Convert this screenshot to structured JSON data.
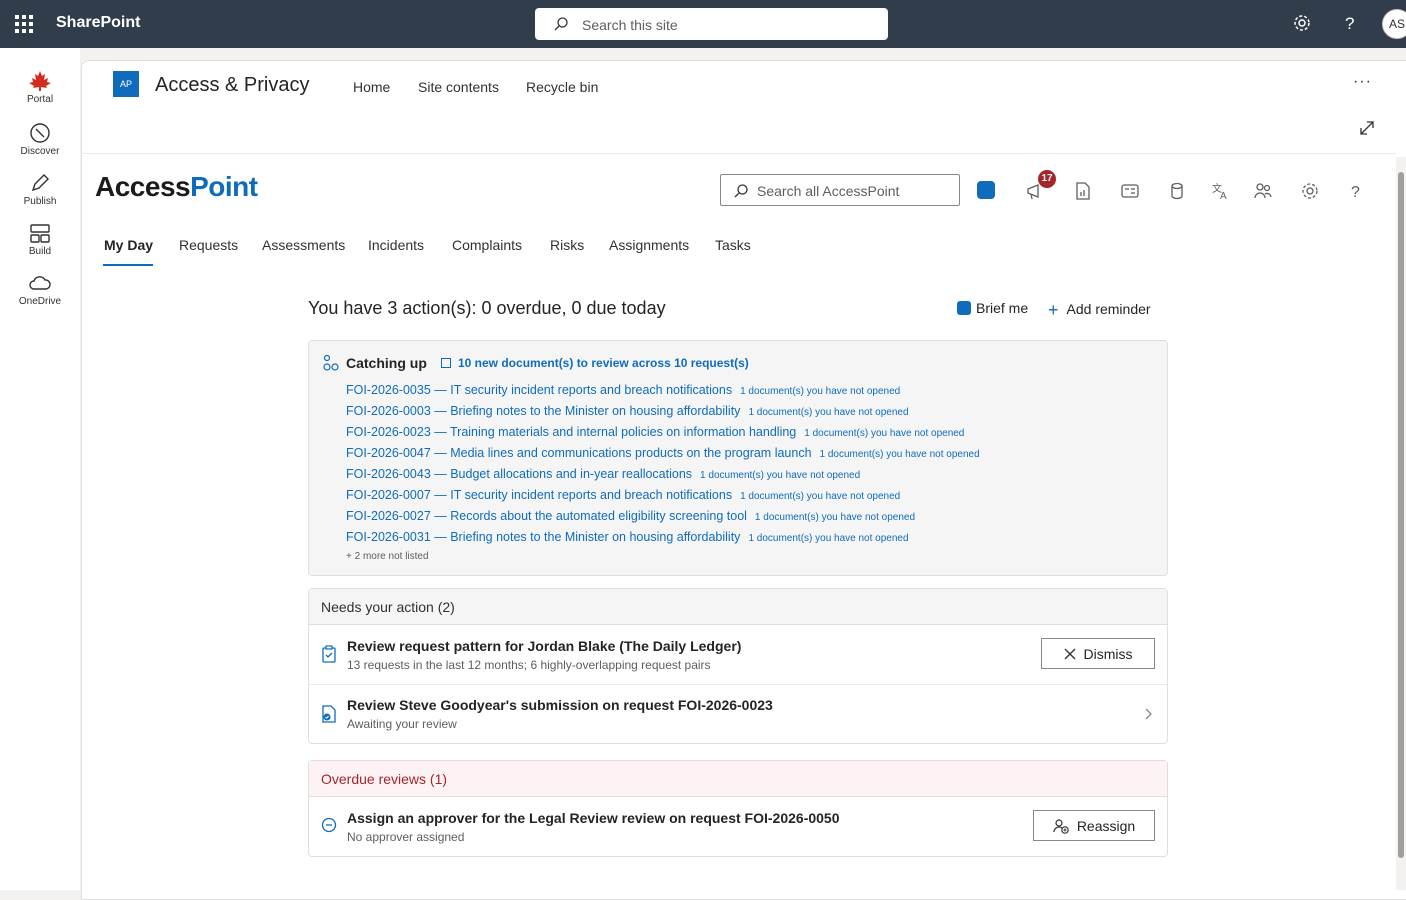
{
  "topbar": {
    "app_name": "SharePoint",
    "search_placeholder": "Search this site",
    "avatar_initials": "AS",
    "icons": [
      "waffle-icon",
      "search-icon",
      "gear-icon",
      "help-icon"
    ]
  },
  "rail": {
    "items": [
      {
        "label": "Portal",
        "icon": "maple-leaf-icon"
      },
      {
        "label": "Discover",
        "icon": "compass-icon"
      },
      {
        "label": "Publish",
        "icon": "pen-icon"
      },
      {
        "label": "Build",
        "icon": "layout-icon"
      },
      {
        "label": "OneDrive",
        "icon": "cloud-icon"
      }
    ]
  },
  "site": {
    "logo": "AP",
    "title": "Access & Privacy",
    "nav": [
      "Home",
      "Site contents",
      "Recycle bin"
    ],
    "more": "···"
  },
  "app": {
    "logo_a": "Access",
    "logo_b": "Point",
    "search_placeholder": "Search all AccessPoint",
    "notification_count": "17",
    "tabs": [
      "My Day",
      "Requests",
      "Assessments",
      "Incidents",
      "Complaints",
      "Risks",
      "Assignments",
      "Tasks"
    ],
    "active_tab": "My Day"
  },
  "myday": {
    "headline": "You have 3 action(s): 0 overdue, 0 due today",
    "brief_me": "Brief me",
    "add_reminder": "Add reminder",
    "catching_up": {
      "title": "Catching up",
      "summary": "10 new document(s) to review across 10 request(s)",
      "requests": [
        {
          "text": "FOI-2026-0035 — IT security incident reports and breach notifications",
          "note": "1 document(s) you have not opened"
        },
        {
          "text": "FOI-2026-0003 — Briefing notes to the Minister on housing affordability",
          "note": "1 document(s) you have not opened"
        },
        {
          "text": "FOI-2026-0023 — Training materials and internal policies on information handling",
          "note": "1 document(s) you have not opened"
        },
        {
          "text": "FOI-2026-0047 — Media lines and communications products on the program launch",
          "note": "1 document(s) you have not opened"
        },
        {
          "text": "FOI-2026-0043 — Budget allocations and in-year reallocations",
          "note": "1 document(s) you have not opened"
        },
        {
          "text": "FOI-2026-0007 — IT security incident reports and breach notifications",
          "note": "1 document(s) you have not opened"
        },
        {
          "text": "FOI-2026-0027 — Records about the automated eligibility screening tool",
          "note": "1 document(s) you have not opened"
        },
        {
          "text": "FOI-2026-0031 — Briefing notes to the Minister on housing affordability",
          "note": "1 document(s) you have not opened"
        }
      ],
      "more": "+ 2 more not listed"
    },
    "needs_action": {
      "title": "Needs your action (2)",
      "items": [
        {
          "title": "Review request pattern for Jordan Blake (The Daily Ledger)",
          "sub": "13 requests in the last 12 months; 6 highly-overlapping request pairs",
          "button": "Dismiss"
        },
        {
          "title": "Review Steve Goodyear's submission on request FOI-2026-0023",
          "sub": "Awaiting your review"
        }
      ]
    },
    "overdue": {
      "title": "Overdue reviews (1)",
      "items": [
        {
          "title": "Assign an approver for the Legal Review review on request FOI-2026-0050",
          "sub": "No approver assigned",
          "button": "Reassign"
        }
      ]
    }
  },
  "colors": {
    "accent": "#0f6cbd",
    "topbar": "#323d4b",
    "alert": "#a4262c"
  }
}
